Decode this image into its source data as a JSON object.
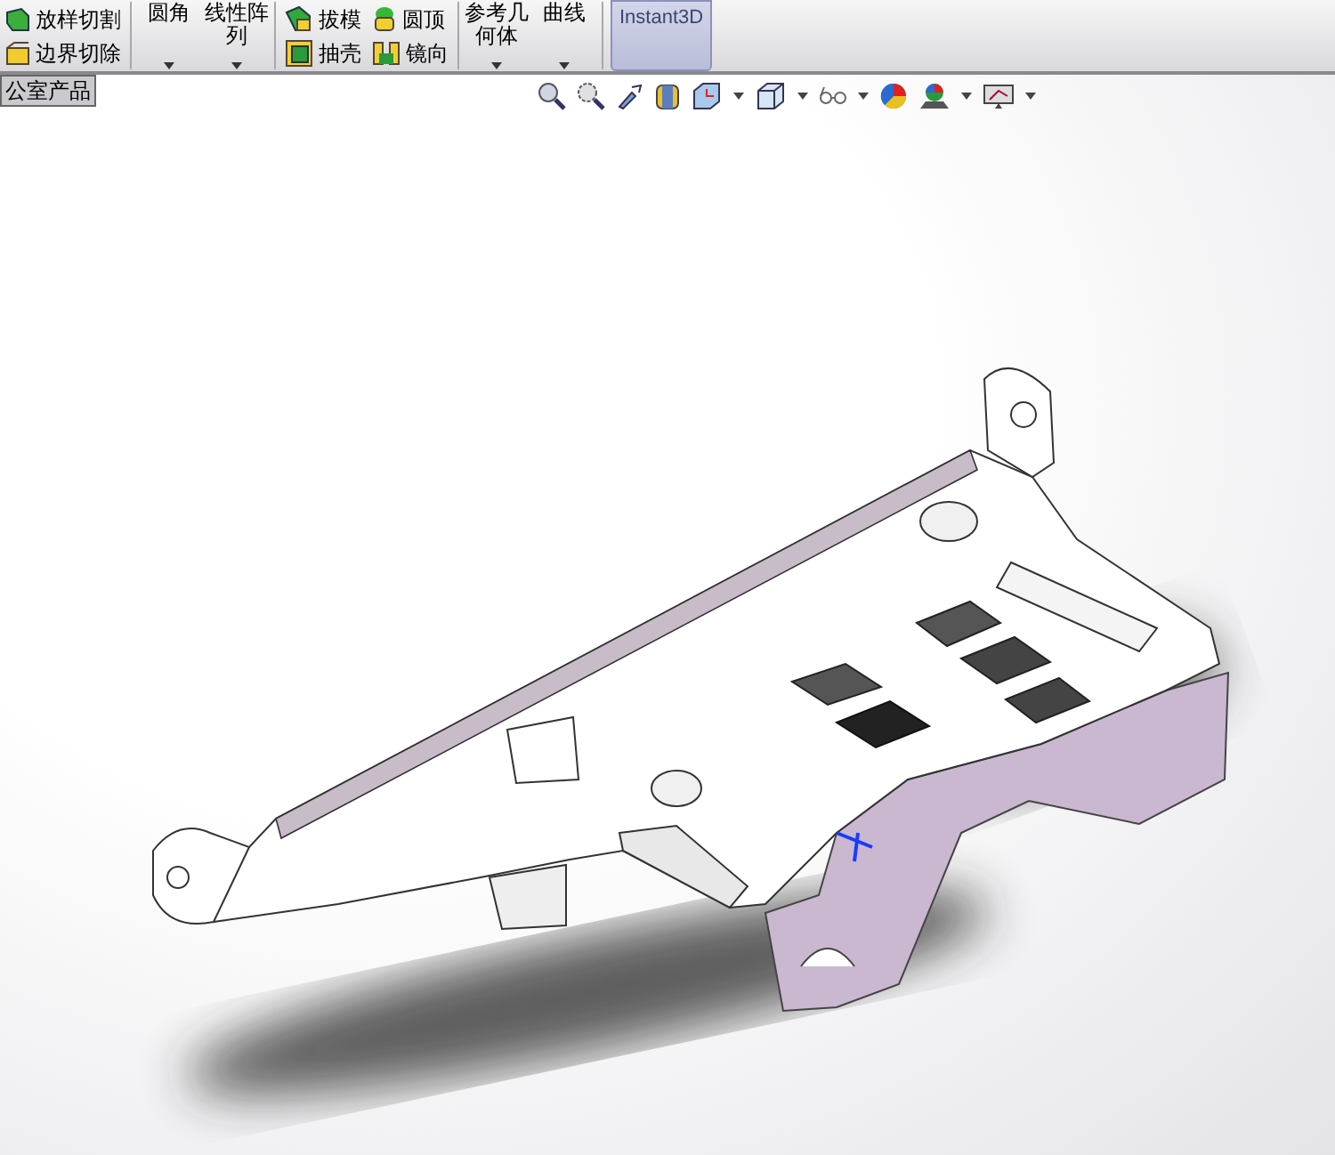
{
  "command_manager": {
    "columns": [
      {
        "kind": "stack",
        "items": [
          {
            "label": "放样切割"
          },
          {
            "label": "边界切除"
          }
        ]
      },
      {
        "kind": "dropdown",
        "label": "圆角"
      },
      {
        "kind": "dropdown",
        "label": "线性阵列"
      },
      {
        "kind": "stack",
        "items": [
          {
            "label": "拔模"
          },
          {
            "label": "抽壳"
          }
        ]
      },
      {
        "kind": "stack",
        "items": [
          {
            "label": "圆顶"
          },
          {
            "label": "镜向"
          }
        ]
      },
      {
        "kind": "dropdown",
        "label": "参考几何体"
      },
      {
        "kind": "dropdown",
        "label": "曲线"
      }
    ],
    "instant3d": {
      "label": "Instant3D",
      "selected": true
    }
  },
  "document_tab": {
    "label": "公室产品"
  }
}
